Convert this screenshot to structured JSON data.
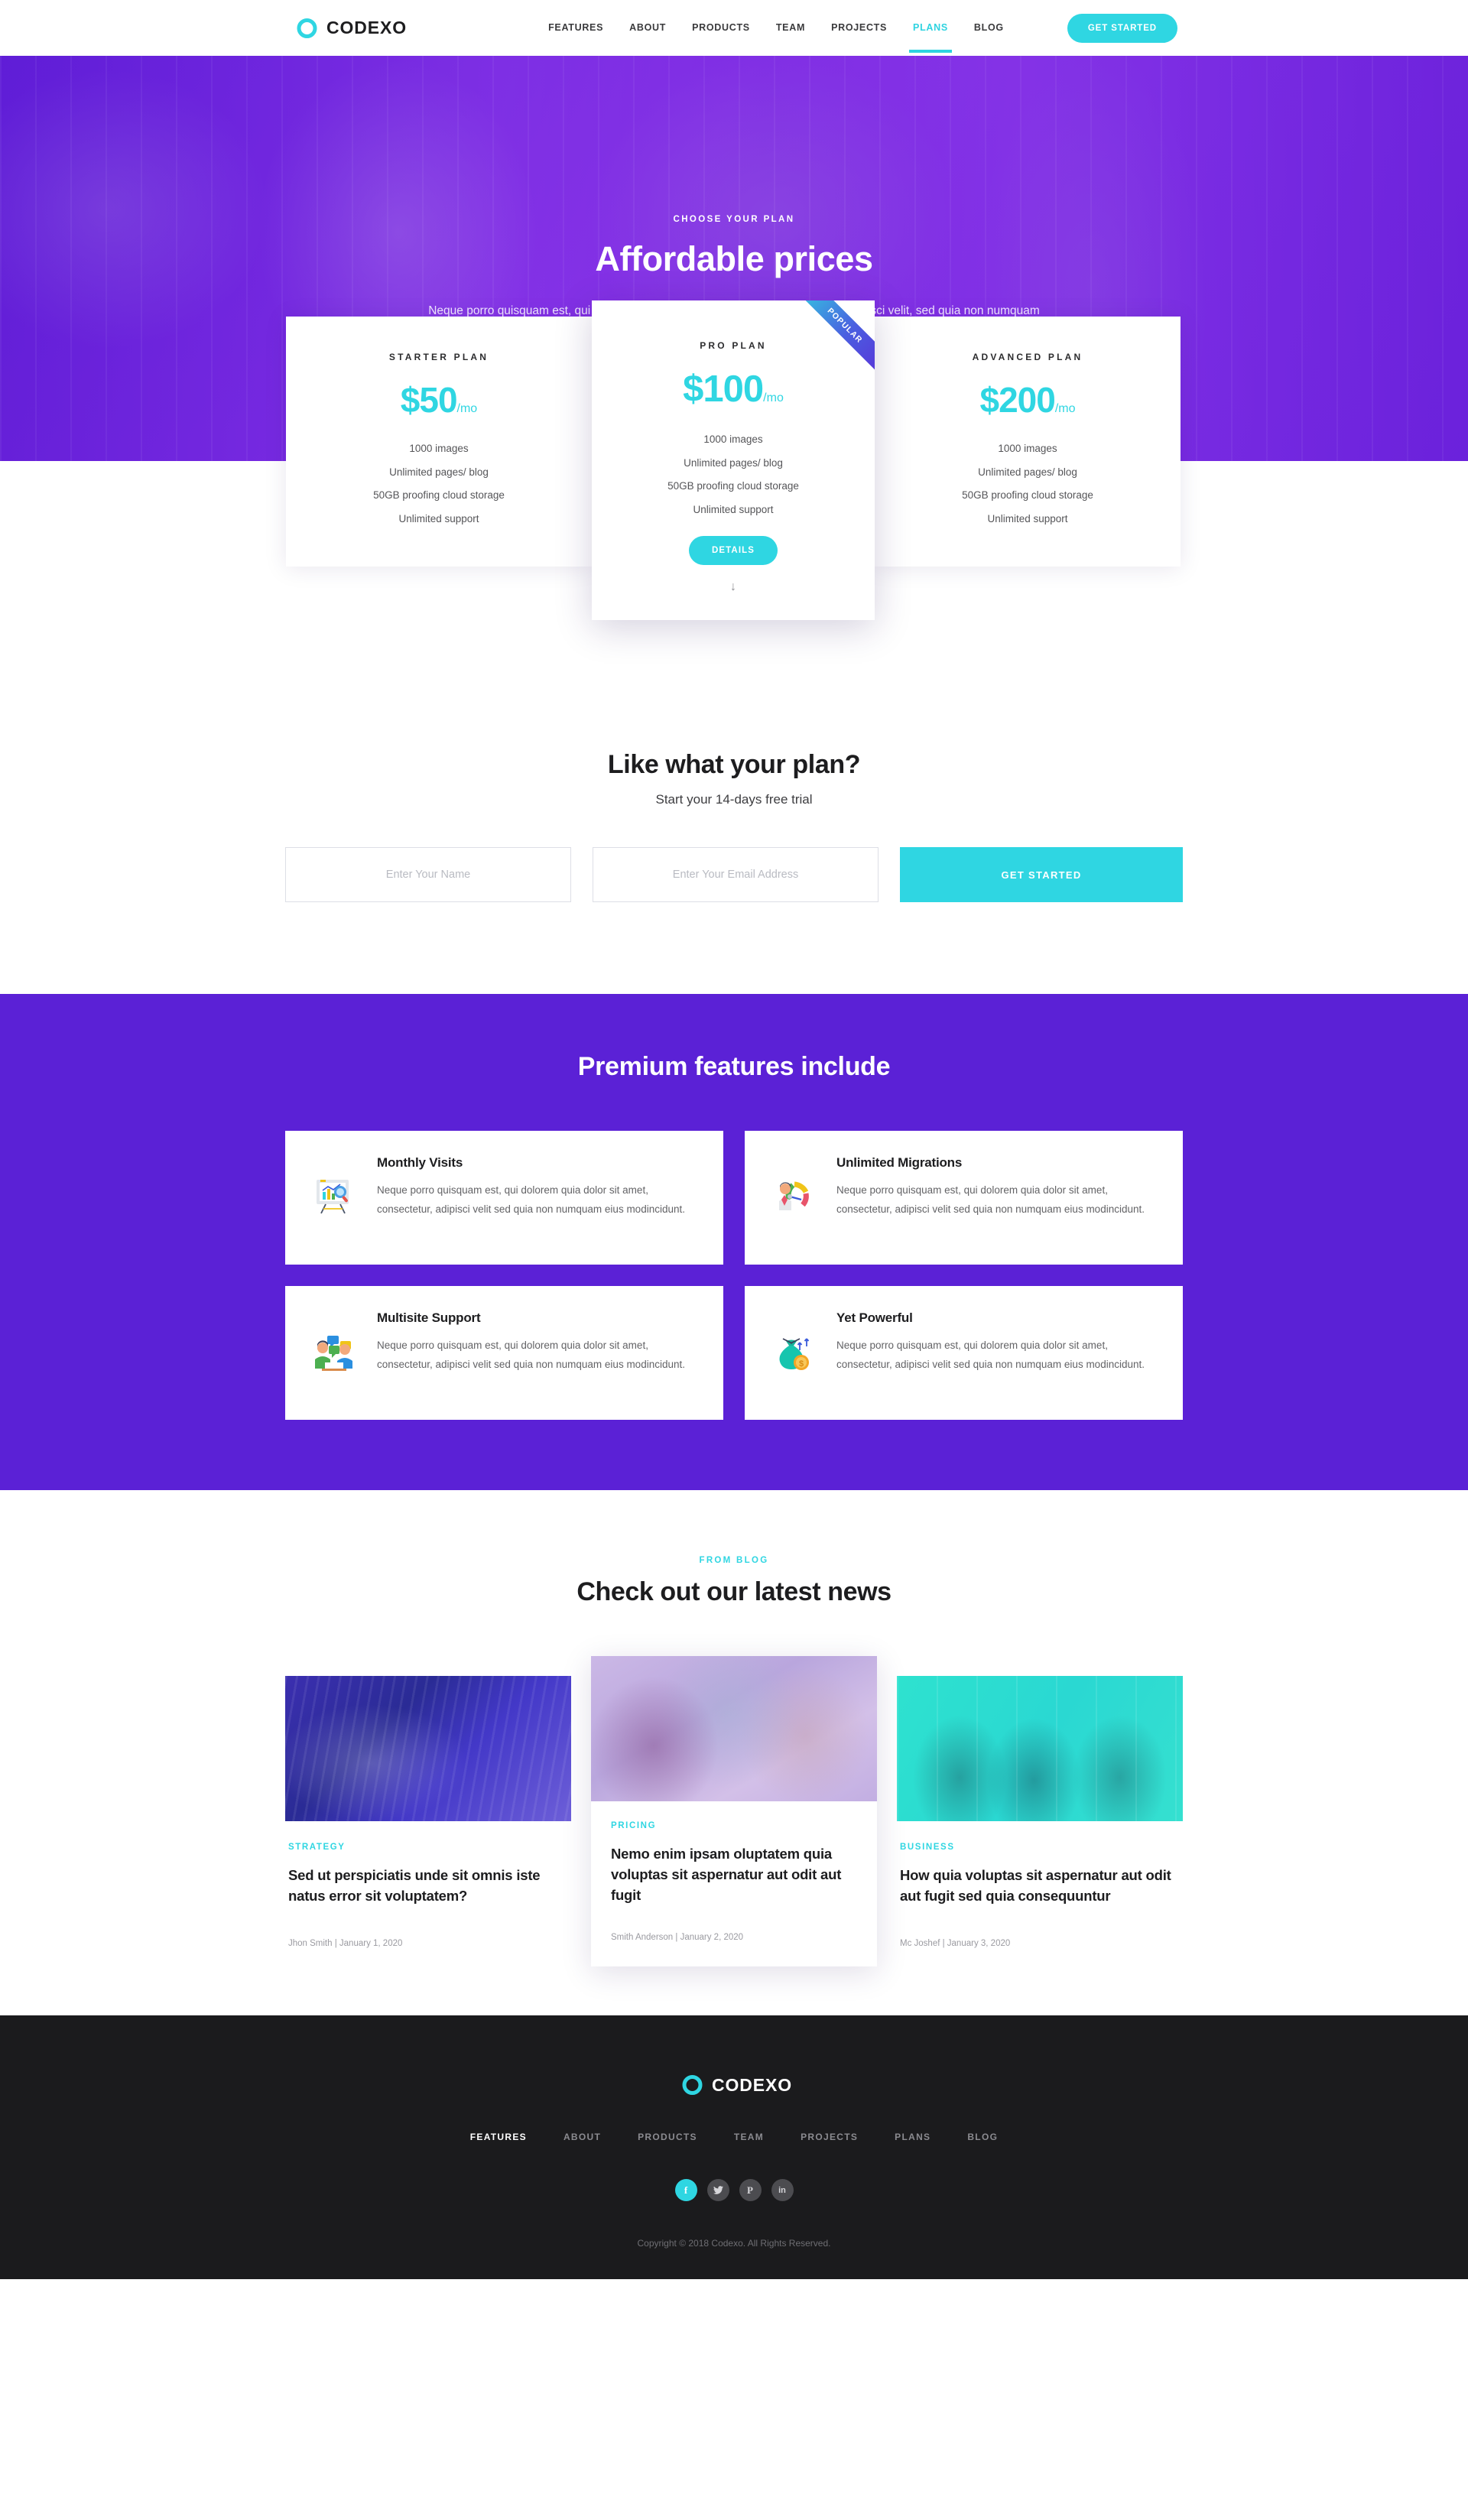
{
  "header": {
    "brand": "CODEXO",
    "nav": [
      {
        "label": "FEATURES",
        "active": false
      },
      {
        "label": "ABOUT",
        "active": false
      },
      {
        "label": "PRODUCTS",
        "active": false
      },
      {
        "label": "TEAM",
        "active": false
      },
      {
        "label": "PROJECTS",
        "active": false
      },
      {
        "label": "PLANS",
        "active": true
      },
      {
        "label": "BLOG",
        "active": false
      }
    ],
    "cta_label": "GET STARTED"
  },
  "hero": {
    "eyebrow": "CHOOSE YOUR PLAN",
    "title": "Affordable prices",
    "subtitle": "Neque porro quisquam est, qui dolorem ipsum quia dolor sit amet, consectetur, adipisci velit, sed quia non numquam eius modi tempora incidunt ut labore et dolore."
  },
  "pricing": {
    "ribbon_label": "POPULAR",
    "details_label": "DETAILS",
    "scroll_arrow": "↓",
    "plans": [
      {
        "name": "STARTER PLAN",
        "amount": "$50",
        "per": "/mo",
        "features": [
          "1000 images",
          "Unlimited pages/ blog",
          "50GB proofing cloud storage",
          "Unlimited support"
        ],
        "featured": false
      },
      {
        "name": "PRO PLAN",
        "amount": "$100",
        "per": "/mo",
        "features": [
          "1000 images",
          "Unlimited pages/ blog",
          "50GB proofing cloud storage",
          "Unlimited support"
        ],
        "featured": true
      },
      {
        "name": "ADVANCED PLAN",
        "amount": "$200",
        "per": "/mo",
        "features": [
          "1000 images",
          "Unlimited pages/ blog",
          "50GB proofing cloud storage",
          "Unlimited support"
        ],
        "featured": false
      }
    ]
  },
  "trial": {
    "title": "Like what your plan?",
    "subtitle": "Start your 14-days free trial",
    "name_placeholder": "Enter Your Name",
    "name_value": "",
    "email_placeholder": "Enter Your Email Address",
    "email_value": "",
    "submit_label": "GET STARTED"
  },
  "features": {
    "title": "Premium features include",
    "cards": [
      {
        "icon": "analytics-chart-icon",
        "title": "Monthly Visits",
        "text": "Neque porro quisquam est, qui dolorem quia dolor sit amet, consectetur, adipisci velit sed quia non numquam eius modincidunt."
      },
      {
        "icon": "performance-gauge-icon",
        "title": "Unlimited Migrations",
        "text": "Neque porro quisquam est, qui dolorem quia dolor sit amet, consectetur, adipisci velit sed quia non numquam eius modincidunt."
      },
      {
        "icon": "team-chat-icon",
        "title": "Multisite Support",
        "text": "Neque porro quisquam est, qui dolorem quia dolor sit amet, consectetur, adipisci velit sed quia non numquam eius modincidunt."
      },
      {
        "icon": "money-bag-icon",
        "title": "Yet Powerful",
        "text": "Neque porro quisquam est, qui dolorem quia dolor sit amet, consectetur, adipisci velit sed quia non numquam eius modincidunt."
      }
    ]
  },
  "blog": {
    "eyebrow": "FROM BLOG",
    "title": "Check out our latest news",
    "posts": [
      {
        "image": "laptop-dashboard-photo",
        "tag": "STRATEGY",
        "headline": "Sed ut perspiciatis unde sit omnis iste natus error sit voluptatem?",
        "meta": "Jhon Smith | January 1, 2020",
        "featured": false
      },
      {
        "image": "team-meeting-photo",
        "tag": "PRICING",
        "headline": "Nemo enim ipsam oluptatem quia voluptas sit aspernatur aut odit aut fugit",
        "meta": "Smith Anderson | January 2, 2020",
        "featured": true
      },
      {
        "image": "celebrating-team-photo",
        "tag": "BUSINESS",
        "headline": "How quia voluptas sit aspernatur aut odit aut fugit sed quia consequuntur",
        "meta": "Mc Joshef | January 3, 2020",
        "featured": false
      }
    ]
  },
  "footer": {
    "brand": "CODEXO",
    "nav": [
      {
        "label": "FEATURES",
        "active": true
      },
      {
        "label": "ABOUT",
        "active": false
      },
      {
        "label": "PRODUCTS",
        "active": false
      },
      {
        "label": "TEAM",
        "active": false
      },
      {
        "label": "PROJECTS",
        "active": false
      },
      {
        "label": "PLANS",
        "active": false
      },
      {
        "label": "BLOG",
        "active": false
      }
    ],
    "socials": [
      {
        "name": "facebook-icon",
        "glyph": "f",
        "active": true
      },
      {
        "name": "twitter-icon",
        "glyph": "ᵗ",
        "active": false
      },
      {
        "name": "pinterest-icon",
        "glyph": "P",
        "active": false
      },
      {
        "name": "linkedin-icon",
        "glyph": "in",
        "active": false
      }
    ],
    "copyright": "Copyright © 2018 Codexo. All Rights Reserved."
  },
  "colors": {
    "accent_cyan": "#2fd6e2",
    "brand_purple": "#5B21D6",
    "dark": "#1b1b1d"
  }
}
